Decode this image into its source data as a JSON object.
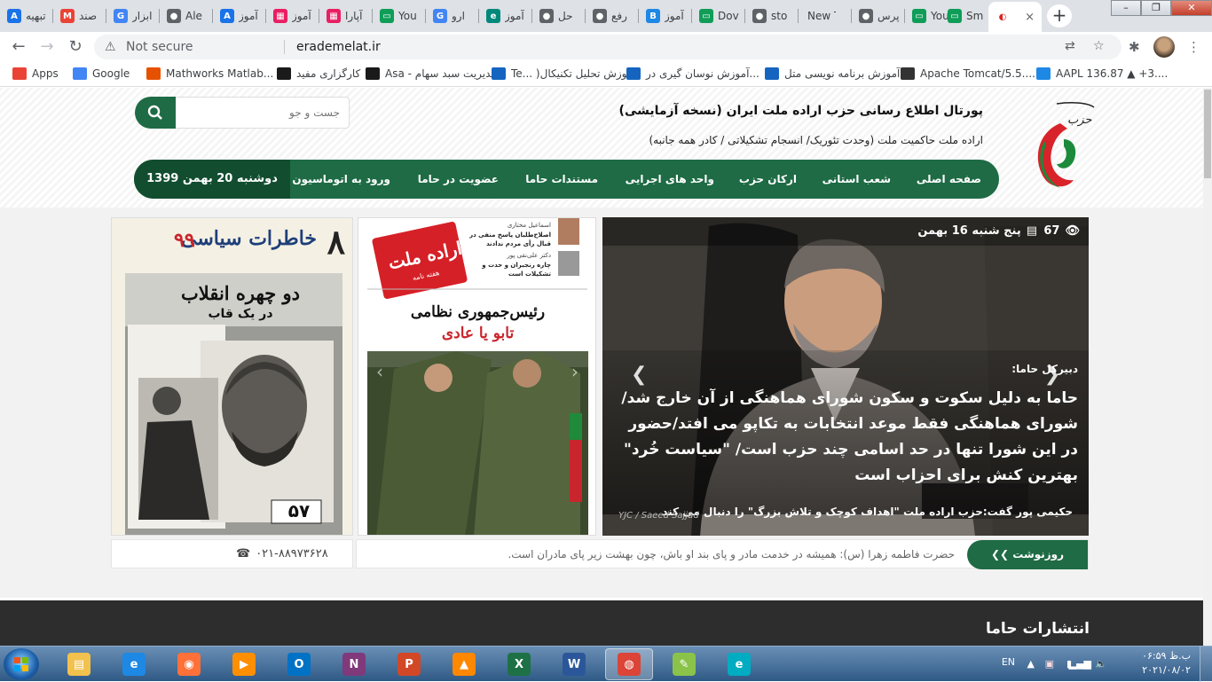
{
  "browser": {
    "tabs": [
      {
        "title": "تبهیه",
        "fav_color": "#1a73e8",
        "fav_glyph": "A"
      },
      {
        "title": "صند",
        "fav_color": "#ea4335",
        "fav_glyph": "M"
      },
      {
        "title": "ابزار",
        "fav_color": "#4285f4",
        "fav_glyph": "G"
      },
      {
        "title": "Ale",
        "fav_color": "#5f6368",
        "fav_glyph": "●"
      },
      {
        "title": "آموز",
        "fav_color": "#1a73e8",
        "fav_glyph": "A"
      },
      {
        "title": "آموز",
        "fav_color": "#e91e63",
        "fav_glyph": "▦"
      },
      {
        "title": "آپارا",
        "fav_color": "#e91e63",
        "fav_glyph": "▦"
      },
      {
        "title": "You",
        "fav_color": "#0f9d58",
        "fav_glyph": "▭"
      },
      {
        "title": "ارو",
        "fav_color": "#4285f4",
        "fav_glyph": "G"
      },
      {
        "title": "آموز",
        "fav_color": "#00897b",
        "fav_glyph": "e"
      },
      {
        "title": "حل",
        "fav_color": "#5f6368",
        "fav_glyph": "●"
      },
      {
        "title": "رفع",
        "fav_color": "#5f6368",
        "fav_glyph": "●"
      },
      {
        "title": "آموز",
        "fav_color": "#1e88e5",
        "fav_glyph": "B"
      },
      {
        "title": "Dov",
        "fav_color": "#0f9d58",
        "fav_glyph": "▭"
      },
      {
        "title": "sto",
        "fav_color": "#5f6368",
        "fav_glyph": "●"
      },
      {
        "title": "New Tal",
        "fav_color": "",
        "fav_glyph": ""
      },
      {
        "title": "پرس",
        "fav_color": "#5f6368",
        "fav_glyph": "●"
      },
      {
        "title": "You",
        "fav_color": "#0f9d58",
        "fav_glyph": "▭"
      },
      {
        "title": "Sm",
        "fav_color": "#0f9d58",
        "fav_glyph": "▭"
      }
    ],
    "active_tab_close": "×",
    "new_tab": "+",
    "window_buttons": {
      "min": "–",
      "max": "❐",
      "close": "✕"
    },
    "security_label": "Not secure",
    "url": "erademelat.ir",
    "bookmarks": [
      {
        "label": "Apps",
        "color": "#ea4335"
      },
      {
        "label": "Google",
        "color": "#4285f4"
      },
      {
        "label": "Mathworks Matlab...",
        "color": "#e65100"
      },
      {
        "label": "کارگزاری مفید",
        "color": "#1a1a1a"
      },
      {
        "label": "Asa - مدیریت سبد سهام",
        "color": "#1a1a1a"
      },
      {
        "label": "Te... )آموزش تحلیل تکنیکال",
        "color": "#1565c0"
      },
      {
        "label": "آموزش نوسان گیری در...",
        "color": "#1565c0"
      },
      {
        "label": "آموزش برنامه نویسی متل...",
        "color": "#1565c0"
      },
      {
        "label": "Apache Tomcat/5.5....",
        "color": "#333333"
      },
      {
        "label": "AAPL 136.87 ▲ +3....",
        "color": "#1e88e5"
      }
    ]
  },
  "site": {
    "title": "پورتال اطلاع رسانی حزب اراده ملت ایران (نسخه آزمایشی)",
    "subtitle": "اراده ملت حاکمیت ملت (وحدت تئوریک/ انسجام تشکیلاتی / کادر همه جانبه)",
    "search_placeholder": "جست و جو",
    "nav": [
      "صفحه اصلی",
      "شعب استانی",
      "ارکان حزب",
      "واحد های اجرایی",
      "مستندات حاما",
      "عضویت در حاما",
      "ورود به اتوماسیون"
    ],
    "date": "دوشنبه 20 بهمن 1399",
    "slider": {
      "views": "67",
      "date": "پنج شنبه 16 بهمن",
      "kicker": "دبیرکل حاما:",
      "headline": "حاما به دلیل سکوت و سکون شورای هماهنگی از آن خارج شد/شورای هماهنگی فقط موعد انتخابات به تکاپو می افتد/حضور در این شورا تنها در حد اسامی چند حزب است/ \"سیاست خُرد\" بهترین کنش برای احزاب است",
      "lead": "حکیمی پور گفت:حزب اراده ملت \"اهداف کوچک و تلاش بزرگ\" را دنبال می کند",
      "credit": "YJC / Saeed Sajjad"
    },
    "newspaper": {
      "masthead": "اراده ملت",
      "masthead_sub": "هفته نامه",
      "side_item_1_name": "اسماعیل مختاری",
      "side_item_1_text": "اصلاح‌طلبان پاسخ منفی در قبال رأی مردم ندادند",
      "side_item_2_name": "دکتر علی‌نقی پور",
      "side_item_2_text": "چاره رنجبران و حدت و تشکیلات است",
      "headline_1": "رئیس‌جمهوری نظامی",
      "headline_2": "تابو یا عادی"
    },
    "magazine": {
      "title": "خاطرات سیاسی",
      "issue": "۹۹",
      "number": "۸",
      "headline_1": "دو چهره انقلاب",
      "headline_2": "در یک قاب",
      "plate": "۵۷"
    },
    "ticker": {
      "label": "روزنوشت",
      "text": "حضرت فاطمه زهرا (س): همیشه در خدمت مادر و پای بند او باش، چون بهشت زیر پای مادران است."
    },
    "phone": "۰۲۱-۸۸۹۷۳۶۲۸",
    "footer_heading": "انتشارات حاما"
  },
  "taskbar": {
    "apps": [
      {
        "name": "explorer",
        "color": "#f2c14e",
        "glyph": "▤"
      },
      {
        "name": "ie",
        "color": "#1e88e5",
        "glyph": "e"
      },
      {
        "name": "firefox",
        "color": "#ff7139",
        "glyph": "◉"
      },
      {
        "name": "media",
        "color": "#ff8f00",
        "glyph": "▶"
      },
      {
        "name": "outlook",
        "color": "#0072c6",
        "glyph": "O"
      },
      {
        "name": "onenote",
        "color": "#80397b",
        "glyph": "N"
      },
      {
        "name": "powerpoint",
        "color": "#d24726",
        "glyph": "P"
      },
      {
        "name": "vlc",
        "color": "#ff8800",
        "glyph": "▲"
      },
      {
        "name": "excel",
        "color": "#1e7145",
        "glyph": "X"
      },
      {
        "name": "word",
        "color": "#2b579a",
        "glyph": "W"
      },
      {
        "name": "chrome",
        "color": "#db4437",
        "glyph": "◍"
      },
      {
        "name": "paint",
        "color": "#8bc34a",
        "glyph": "✎"
      },
      {
        "name": "edraw",
        "color": "#00acc1",
        "glyph": "e"
      }
    ],
    "lang": "EN",
    "time": "ب.ظ ۰۶:۵۹",
    "date": "۲۰۲۱/۰۸/۰۲"
  }
}
